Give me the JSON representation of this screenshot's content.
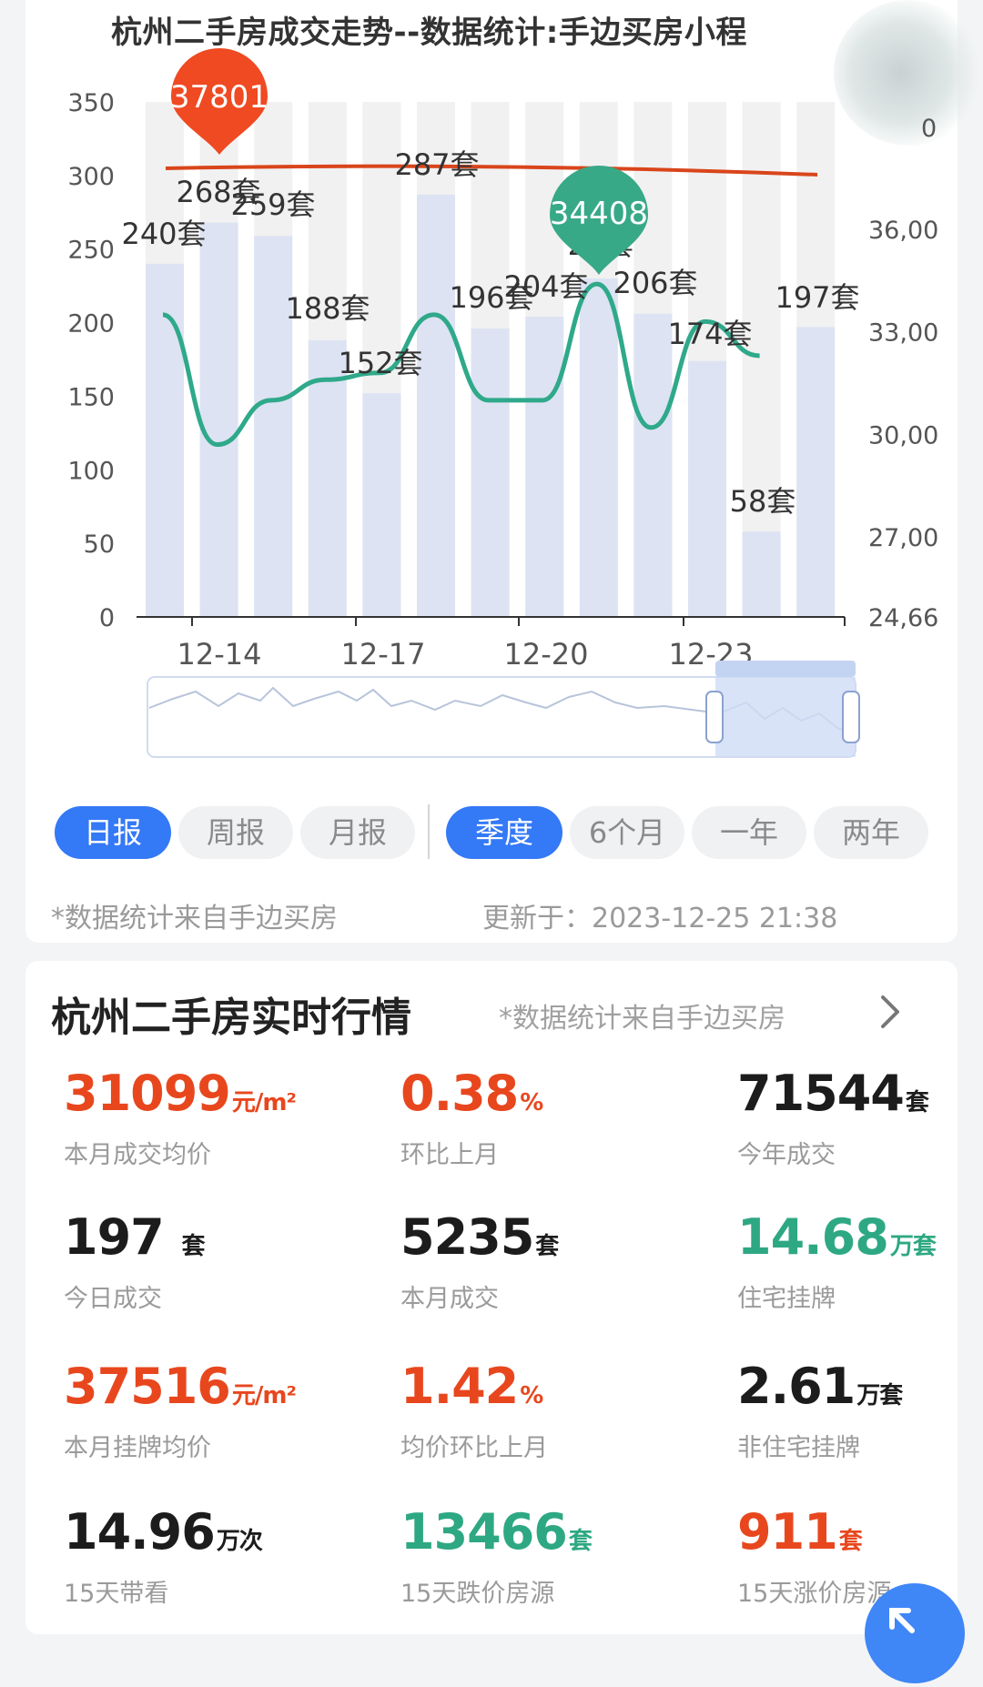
{
  "chart": {
    "title": "杭州二手房成交走势--数据统计:手边买房小程",
    "colors": {
      "bar_fill": "#dde3f3",
      "bar_bg": "#f1f1f1",
      "line": "#2fa98a",
      "max_pin": "#ef4a22",
      "max_line": "#d9451b",
      "min_pin": "#38a987"
    },
    "pin_max_label": "37801",
    "pin_min_label": "34408"
  },
  "chart_data": {
    "type": "bar",
    "left_axis_ticks": [
      "350",
      "300",
      "250",
      "200",
      "150",
      "100",
      "50",
      "0"
    ],
    "right_axis_ticks": [
      "36,00",
      "33,00",
      "30,00",
      "27,00",
      "24,66"
    ],
    "right_axis_partial_tick": "0",
    "x_tick_labels": [
      "12-14",
      "12-17",
      "12-20",
      "12-23"
    ],
    "bar_labels": [
      "240套",
      "268套",
      "259套",
      "188套",
      "152套",
      "287套",
      "196套",
      "204套",
      "23套",
      "206套",
      "174套",
      "58套",
      "197套"
    ],
    "ylim": [
      0,
      350
    ],
    "series": [
      {
        "values": [
          240,
          268,
          259,
          188,
          152,
          287,
          196,
          204,
          230,
          206,
          174,
          58,
          197
        ]
      },
      {
        "values": [
          33500,
          29700,
          31000,
          31600,
          31800,
          33500,
          31000,
          31000,
          34400,
          30200,
          33300,
          32300
        ]
      }
    ],
    "max_price_value": 37801,
    "min_pin_value": 34408
  },
  "tabs": {
    "period": [
      "日报",
      "周报",
      "月报"
    ],
    "range": [
      "季度",
      "6个月",
      "一年",
      "两年"
    ]
  },
  "chart_footer": {
    "source": "*数据统计来自手边买房",
    "updated": "更新于：2023-12-25 21:38"
  },
  "market": {
    "title": "杭州二手房实时行情",
    "note": "*数据统计来自手边买房",
    "stats": [
      {
        "value": "31099",
        "unit": "元/m²",
        "label": "本月成交均价",
        "color": "red"
      },
      {
        "value": "0.38",
        "unit": "%",
        "label": "环比上月",
        "color": "red"
      },
      {
        "value": "71544",
        "unit": "套",
        "label": "今年成交",
        "color": "black"
      },
      {
        "value": "197 ",
        "unit": "套",
        "label": "今日成交",
        "color": "black"
      },
      {
        "value": "5235",
        "unit": "套",
        "label": "本月成交",
        "color": "black"
      },
      {
        "value": "14.68",
        "unit": "万套",
        "label": "住宅挂牌",
        "color": "green"
      },
      {
        "value": "37516",
        "unit": "元/m²",
        "label": "本月挂牌均价",
        "color": "red"
      },
      {
        "value": "1.42",
        "unit": "%",
        "label": "均价环比上月",
        "color": "red"
      },
      {
        "value": "2.61",
        "unit": "万套",
        "label": "非住宅挂牌",
        "color": "black"
      },
      {
        "value": "14.96",
        "unit": "万次",
        "label": "15天带看",
        "color": "black"
      },
      {
        "value": "13466",
        "unit": "套",
        "label": "15天跌价房源",
        "color": "green"
      },
      {
        "value": "911",
        "unit": "套",
        "label": "15天涨价房源",
        "color": "red"
      }
    ]
  }
}
